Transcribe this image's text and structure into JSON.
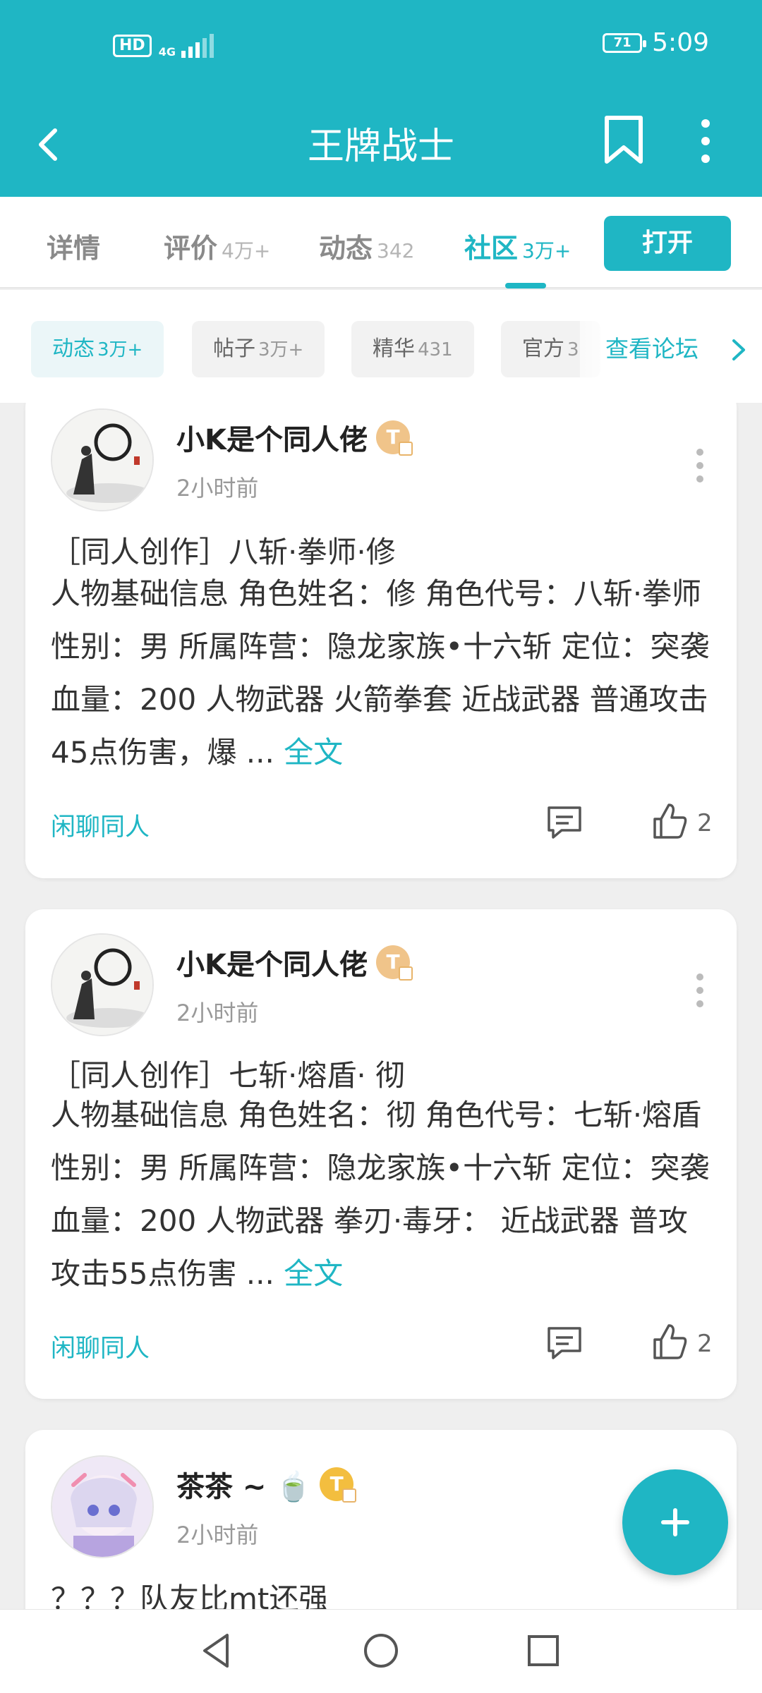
{
  "status_bar": {
    "hd": "HD",
    "network": "4G",
    "battery": "71",
    "time": "5:09"
  },
  "app_bar": {
    "title": "王牌战士"
  },
  "tabs": [
    {
      "label": "详情",
      "count": ""
    },
    {
      "label": "评价",
      "count": "4万+"
    },
    {
      "label": "动态",
      "count": "342"
    },
    {
      "label": "社区",
      "count": "3万+",
      "active": true
    }
  ],
  "open_button": "打开",
  "filters": {
    "chips": [
      {
        "label": "动态",
        "count": "3万+",
        "active": true
      },
      {
        "label": "帖子",
        "count": "3万+"
      },
      {
        "label": "精华",
        "count": "431"
      },
      {
        "label": "官方",
        "count": "3"
      }
    ],
    "forum_link": "查看论坛"
  },
  "posts": [
    {
      "username": "小K是个同人佬",
      "badge": "T",
      "time": "2小时前",
      "title": "［同人创作］八斩·拳师·修",
      "body": "人物基础信息 角色姓名：修 角色代号：八斩·拳师 性别：男 所属阵营：隐龙家族•十六斩 定位：突袭 血量：200 人物武器 火箭拳套 近战武器 普通攻击45点伤害，爆 ...",
      "more": "全文",
      "topic": "闲聊同人",
      "likes": "2"
    },
    {
      "username": "小K是个同人佬",
      "badge": "T",
      "time": "2小时前",
      "title": "［同人创作］七斩·熔盾· 彻",
      "body": "人物基础信息 角色姓名：彻 角色代号：七斩·熔盾 性别：男 所属阵营：隐龙家族•十六斩 定位：突袭 血量：200 人物武器 拳刃·毒牙： 近战武器 普攻攻击55点伤害 ...",
      "more": "全文",
      "topic": "闲聊同人",
      "likes": "2"
    },
    {
      "username": "茶茶 ~ 🍵",
      "badge": "T",
      "time": "2小时前",
      "title": "？？？队友比mt还强"
    }
  ],
  "colors": {
    "accent": "#1fb6c4"
  }
}
